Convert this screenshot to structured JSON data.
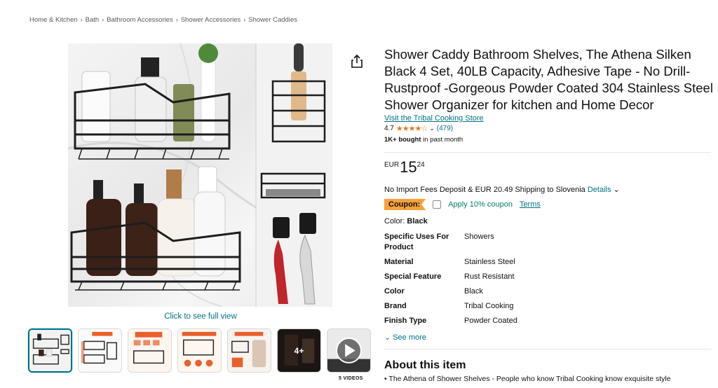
{
  "breadcrumb": [
    "Home & Kitchen",
    "Bath",
    "Bathroom Accessories",
    "Shower Accessories",
    "Shower Caddies"
  ],
  "breadcrumb_separator": "›",
  "gallery": {
    "full_view_label": "Click to see full view",
    "more_count": "4+",
    "videos_label": "5 VIDEOS"
  },
  "product": {
    "title": "Shower Caddy Bathroom Shelves, The Athena Silken Black 4 Set, 40LB Capacity, Adhesive Tape - No Drill-Rustproof -Gorgeous Powder Coated 304 Stainless Steel Shower Organizer for kitchen and Home Decor",
    "store_link": "Visit the Tribal Cooking Store",
    "rating": "4.7",
    "stars_fraction": 0.94,
    "rating_count": "(479)",
    "bought_bold": "1K+ bought",
    "bought_rest": " in past month",
    "price": {
      "currency": "EUR",
      "whole": "15",
      "fraction": "24"
    },
    "shipping_text": "No Import Fees Deposit & EUR 20.49 Shipping to Slovenia ",
    "shipping_link": "Details",
    "coupon": {
      "badge": "Coupon:",
      "text": "Apply 10% coupon",
      "terms": "Terms"
    },
    "color_label": "Color: ",
    "color_value": "Black",
    "specs": [
      {
        "key": "Specific Uses For Product",
        "value": "Showers"
      },
      {
        "key": "Material",
        "value": "Stainless Steel"
      },
      {
        "key": "Special Feature",
        "value": "Rust Resistant"
      },
      {
        "key": "Color",
        "value": "Black"
      },
      {
        "key": "Brand",
        "value": "Tribal Cooking"
      },
      {
        "key": "Finish Type",
        "value": "Powder Coated"
      }
    ],
    "see_more": "See more",
    "about_heading": "About this item",
    "about_first": "The Athena of Shower Shelves - People who know Tribal Cooking know exquisite style"
  },
  "colors": {
    "link": "#007185",
    "star": "#de7921",
    "coupon_badge": "#f7a23b",
    "coupon_text": "#067d62"
  }
}
